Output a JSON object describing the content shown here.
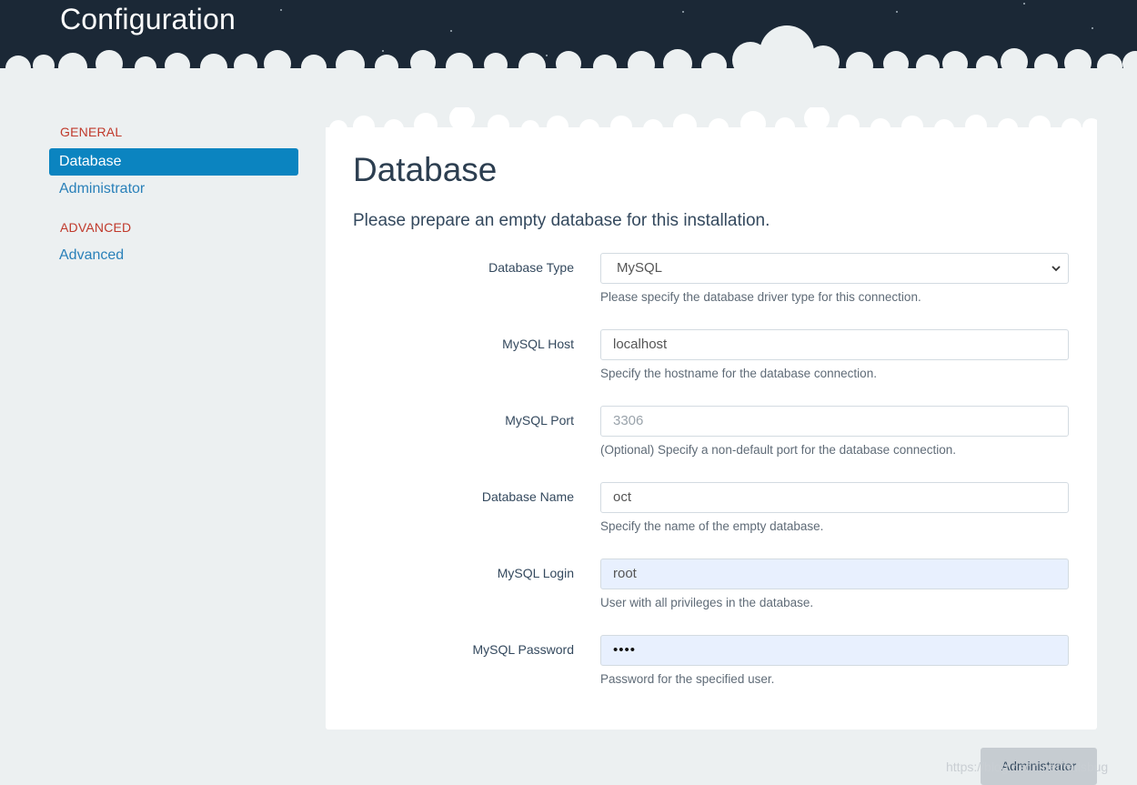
{
  "header": {
    "title": "Configuration"
  },
  "sidebar": {
    "groups": [
      {
        "label": "GENERAL",
        "items": [
          {
            "label": "Database",
            "active": true
          },
          {
            "label": "Administrator",
            "active": false
          }
        ]
      },
      {
        "label": "ADVANCED",
        "items": [
          {
            "label": "Advanced",
            "active": false
          }
        ]
      }
    ]
  },
  "panel": {
    "title": "Database",
    "lead": "Please prepare an empty database for this installation.",
    "fields": [
      {
        "label": "Database Type",
        "value": "MySQL",
        "type": "select",
        "help": "Please specify the database driver type for this connection."
      },
      {
        "label": "MySQL Host",
        "value": "localhost",
        "type": "text",
        "help": "Specify the hostname for the database connection."
      },
      {
        "label": "MySQL Port",
        "placeholder": "3306",
        "value": "",
        "type": "text",
        "help": "(Optional) Specify a non-default port for the database connection."
      },
      {
        "label": "Database Name",
        "value": "oct",
        "type": "text",
        "help": "Specify the name of the empty database."
      },
      {
        "label": "MySQL Login",
        "value": "root",
        "type": "text",
        "autofill": true,
        "help": "User with all privileges in the database."
      },
      {
        "label": "MySQL Password",
        "value": "••••",
        "type": "password",
        "autofill": true,
        "help": "Password for the specified user."
      }
    ]
  },
  "footer": {
    "next_label": "Administrator",
    "watermark": "https://blog.csdn.net/railsbug"
  },
  "colors": {
    "header_bg": "#1b2836",
    "page_bg": "#ecf0f1",
    "accent": "#0b84c0",
    "group_label": "#c0392b",
    "autofill_bg": "#e8f0fe"
  }
}
